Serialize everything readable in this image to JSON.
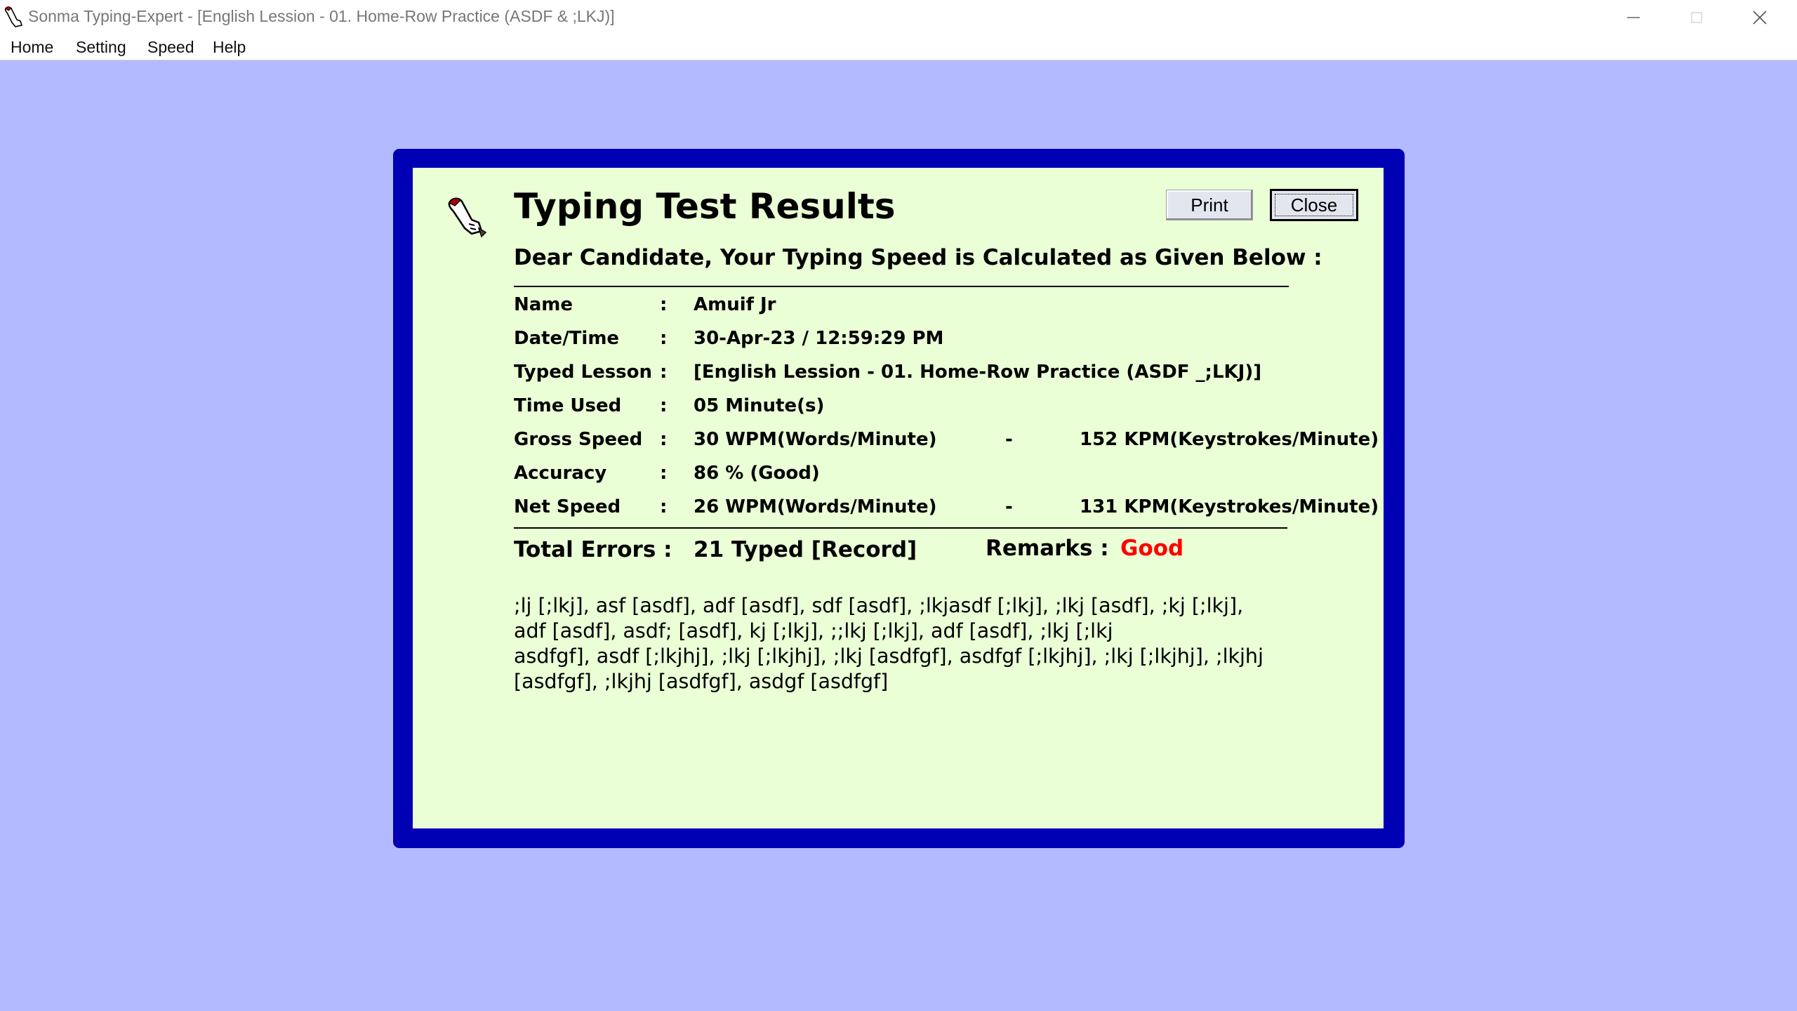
{
  "window": {
    "title": "Sonma Typing-Expert - [English Lession - 01. Home-Row Practice (ASDF & ;LKJ)]"
  },
  "menu": {
    "items": [
      "Home",
      "Setting",
      "Speed",
      "Help"
    ]
  },
  "dialog": {
    "title": "Typing Test Results",
    "subtitle": "Dear Candidate, Your Typing Speed is Calculated as Given Below :",
    "print_label": "Print",
    "close_label": "Close",
    "colon": ":",
    "dash": "-",
    "rows": {
      "name": {
        "label": "Name",
        "value": "Amuif Jr"
      },
      "datetime": {
        "label": "Date/Time",
        "value": "30-Apr-23 / 12:59:29 PM"
      },
      "lesson": {
        "label": "Typed Lesson",
        "value": "[English Lession - 01. Home-Row Practice (ASDF _;LKJ)]"
      },
      "time_used": {
        "label": "Time Used",
        "value": "05 Minute(s)"
      },
      "gross_speed": {
        "label": "Gross Speed",
        "value": "30 WPM(Words/Minute)",
        "value2": "152 KPM(Keystrokes/Minute)"
      },
      "accuracy": {
        "label": "Accuracy",
        "value": "86 % (Good)"
      },
      "net_speed": {
        "label": "Net Speed",
        "value": "26 WPM(Words/Minute)",
        "value2": "131 KPM(Keystrokes/Minute)"
      }
    },
    "total_errors_label": "Total Errors :",
    "total_errors_value": "21 Typed [Record]",
    "remarks_label": "Remarks :",
    "remarks_value": "Good",
    "remarks_color": "#ff0000",
    "errors_lines": [
      ";lj [;lkj], asf [asdf], adf [asdf], sdf [asdf], ;lkjasdf [;lkj], ;lkj [asdf], ;kj [;lkj],",
      "adf [asdf], asdf; [asdf], kj [;lkj], ;;lkj [;lkj], adf [asdf], ;lkj [;lkj",
      "asdfgf], asdf [;lkjhj], ;lkj [;lkjhj], ;lkj [asdfgf], asdfgf [;lkjhj], ;lkj [;lkjhj], ;lkjhj",
      "[asdfgf], ;lkjhj [asdfgf], asdgf [asdfgf]"
    ]
  },
  "colors": {
    "background": "#b4baff",
    "frame": "#0000b4",
    "panel": "#eaffd6"
  }
}
